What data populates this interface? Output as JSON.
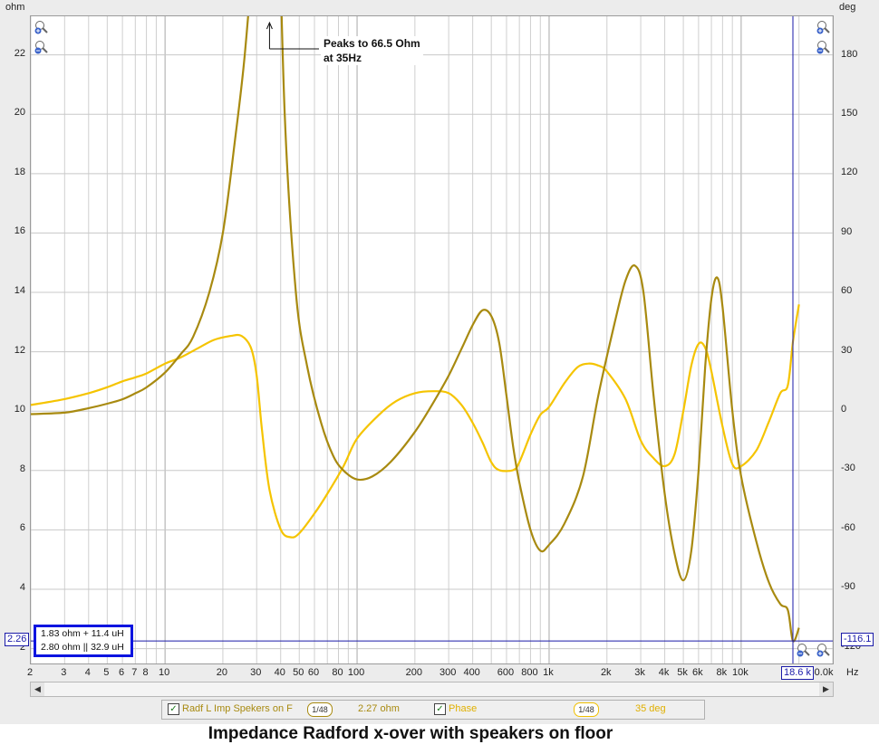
{
  "caption": "Impedance Radford x-over with speakers on floor",
  "colors": {
    "impedance": "#a88a10",
    "phase": "#f5c400",
    "cursor": "#1a1aa8",
    "grid": "#c4c4c4"
  },
  "axes": {
    "left_unit": "ohm",
    "right_unit": "deg",
    "x_unit": "Hz",
    "left_ticks": [
      "2",
      "4",
      "6",
      "8",
      "10",
      "12",
      "14",
      "16",
      "18",
      "20",
      "22"
    ],
    "right_ticks": [
      "-120",
      "-90",
      "-60",
      "-30",
      "0",
      "30",
      "60",
      "90",
      "120",
      "150",
      "180"
    ],
    "x_ticks": [
      "2",
      "3",
      "4",
      "5",
      "6",
      "7",
      "8",
      "10",
      "20",
      "30",
      "40",
      "50",
      "60",
      "80",
      "100",
      "200",
      "300",
      "400",
      "600",
      "800",
      "1k",
      "2k",
      "3k",
      "4k",
      "5k",
      "6k",
      "8k",
      "10k",
      "20k",
      "30.0k"
    ]
  },
  "annotation": {
    "line1": "Peaks to 66.5 Ohm",
    "line2": "at 35Hz"
  },
  "cursor": {
    "left_value": "2.26",
    "right_value": "-116.1",
    "x_value": "18.6 k"
  },
  "info": {
    "line1": "1.83 ohm + 11.4 uH",
    "line2": "2.80 ohm || 32.9 uH"
  },
  "legend": {
    "trace1_name": "Radf L Imp Spekers on F",
    "trace1_smoothing": "1/48",
    "trace1_value": "2.27 ohm",
    "trace2_name": "Phase",
    "trace2_smoothing": "1/48",
    "trace2_value": "35 deg",
    "check_mark": "✓"
  },
  "scrollbar": {
    "left_arrow": "◀",
    "right_arrow": "▶"
  },
  "chart_data": {
    "type": "line",
    "xscale": "log",
    "xlim": [
      2,
      30000
    ],
    "ylim_left": [
      1.5,
      23.3
    ],
    "ylim_right": [
      -128,
      200
    ],
    "xlabel": "Hz",
    "ylabel_left": "ohm",
    "ylabel_right": "deg",
    "grid": true,
    "series": [
      {
        "name": "Radf L Imp Spekers on F",
        "axis": "left",
        "points": [
          [
            2,
            9.9
          ],
          [
            3,
            9.95
          ],
          [
            4,
            10.1
          ],
          [
            5,
            10.25
          ],
          [
            6,
            10.4
          ],
          [
            7,
            10.6
          ],
          [
            8,
            10.8
          ],
          [
            10,
            11.3
          ],
          [
            12,
            11.9
          ],
          [
            14,
            12.5
          ],
          [
            17,
            14.0
          ],
          [
            20,
            16.0
          ],
          [
            23,
            19.0
          ],
          [
            26,
            22.0
          ],
          [
            29,
            26.0
          ],
          [
            32,
            32.0
          ],
          [
            35,
            66.5
          ],
          [
            38,
            30.0
          ],
          [
            42,
            20.0
          ],
          [
            48,
            14.0
          ],
          [
            55,
            11.5
          ],
          [
            65,
            9.6
          ],
          [
            75,
            8.5
          ],
          [
            85,
            8.0
          ],
          [
            100,
            7.7
          ],
          [
            120,
            7.8
          ],
          [
            150,
            8.3
          ],
          [
            200,
            9.3
          ],
          [
            250,
            10.3
          ],
          [
            300,
            11.2
          ],
          [
            350,
            12.1
          ],
          [
            400,
            12.9
          ],
          [
            450,
            13.4
          ],
          [
            500,
            13.2
          ],
          [
            550,
            12.3
          ],
          [
            600,
            10.5
          ],
          [
            650,
            8.8
          ],
          [
            700,
            7.6
          ],
          [
            800,
            6.0
          ],
          [
            900,
            5.3
          ],
          [
            1000,
            5.5
          ],
          [
            1200,
            6.2
          ],
          [
            1500,
            7.8
          ],
          [
            1800,
            10.5
          ],
          [
            2200,
            13.0
          ],
          [
            2500,
            14.4
          ],
          [
            2800,
            14.9
          ],
          [
            3100,
            14.0
          ],
          [
            3500,
            10.5
          ],
          [
            4000,
            7.2
          ],
          [
            4500,
            5.2
          ],
          [
            5000,
            4.3
          ],
          [
            5500,
            5.3
          ],
          [
            6000,
            8.0
          ],
          [
            6500,
            11.5
          ],
          [
            7000,
            13.8
          ],
          [
            7500,
            14.5
          ],
          [
            8000,
            13.5
          ],
          [
            9000,
            10.0
          ],
          [
            10000,
            7.8
          ],
          [
            12000,
            5.6
          ],
          [
            14000,
            4.2
          ],
          [
            16000,
            3.5
          ],
          [
            17500,
            3.3
          ],
          [
            18600,
            2.26
          ],
          [
            20000,
            2.7
          ]
        ]
      },
      {
        "name": "Phase",
        "axis": "right",
        "points": [
          [
            2,
            3
          ],
          [
            3,
            6
          ],
          [
            4,
            9
          ],
          [
            5,
            12
          ],
          [
            6,
            15
          ],
          [
            7,
            17
          ],
          [
            8,
            19
          ],
          [
            10,
            24
          ],
          [
            12,
            27
          ],
          [
            15,
            32
          ],
          [
            18,
            36
          ],
          [
            22,
            38
          ],
          [
            25,
            38
          ],
          [
            28,
            32
          ],
          [
            30,
            18
          ],
          [
            32,
            -10
          ],
          [
            35,
            -40
          ],
          [
            40,
            -60
          ],
          [
            45,
            -64
          ],
          [
            50,
            -62
          ],
          [
            60,
            -52
          ],
          [
            70,
            -42
          ],
          [
            85,
            -28
          ],
          [
            100,
            -14
          ],
          [
            130,
            -2
          ],
          [
            160,
            5
          ],
          [
            200,
            9
          ],
          [
            250,
            10
          ],
          [
            300,
            9
          ],
          [
            350,
            3
          ],
          [
            400,
            -6
          ],
          [
            450,
            -16
          ],
          [
            500,
            -26
          ],
          [
            550,
            -30
          ],
          [
            650,
            -30
          ],
          [
            700,
            -26
          ],
          [
            800,
            -12
          ],
          [
            900,
            -2
          ],
          [
            1000,
            2
          ],
          [
            1200,
            14
          ],
          [
            1400,
            22
          ],
          [
            1600,
            24
          ],
          [
            1800,
            23
          ],
          [
            2000,
            20
          ],
          [
            2500,
            6
          ],
          [
            3000,
            -15
          ],
          [
            3500,
            -24
          ],
          [
            4000,
            -28
          ],
          [
            4500,
            -22
          ],
          [
            5000,
            0
          ],
          [
            5500,
            23
          ],
          [
            6000,
            34
          ],
          [
            6500,
            32
          ],
          [
            7000,
            20
          ],
          [
            8000,
            -8
          ],
          [
            9000,
            -27
          ],
          [
            10000,
            -28
          ],
          [
            12000,
            -20
          ],
          [
            14000,
            -5
          ],
          [
            16000,
            9
          ],
          [
            17500,
            13
          ],
          [
            18600,
            35
          ],
          [
            20000,
            54
          ]
        ]
      }
    ]
  }
}
